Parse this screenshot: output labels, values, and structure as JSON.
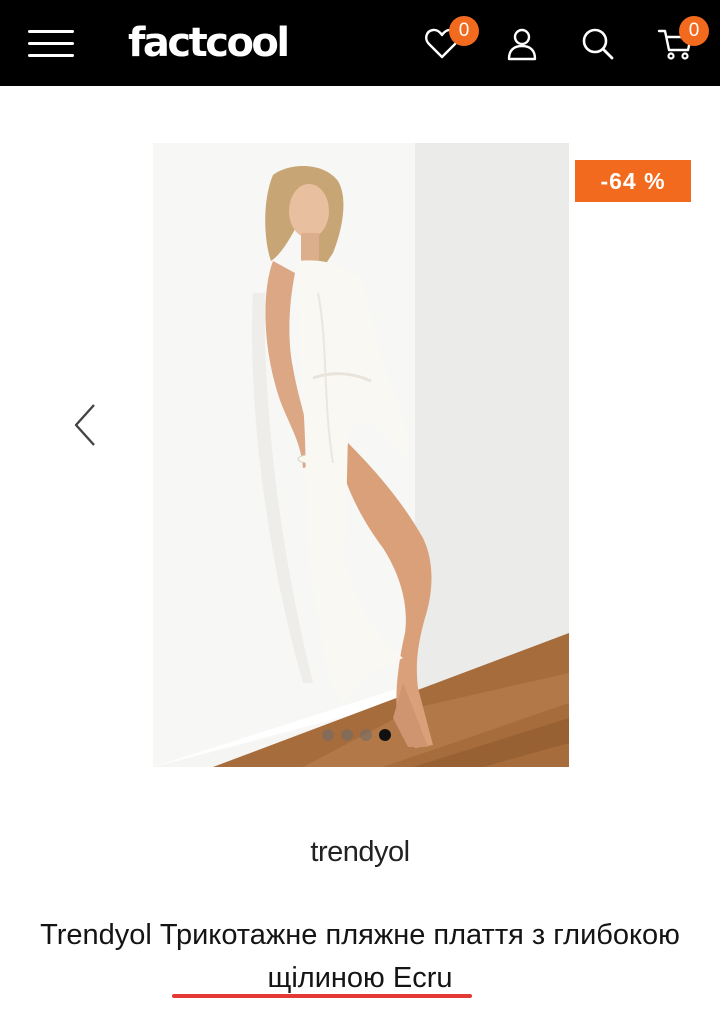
{
  "header": {
    "logo": "factcool",
    "wishlist_count": "0",
    "cart_count": "0",
    "icons": [
      "menu-icon",
      "heart-icon",
      "user-icon",
      "search-icon",
      "cart-icon"
    ]
  },
  "gallery": {
    "discount": "-64 %",
    "slide_count": 4,
    "active_slide": 4
  },
  "product": {
    "brand": "trendyol",
    "title": "Trendyol Трикотажне пляжне плаття з глибокою щілиною Ecru"
  },
  "colors": {
    "header_bg": "#000000",
    "accent": "#f26a1d",
    "underline": "#e53935"
  }
}
